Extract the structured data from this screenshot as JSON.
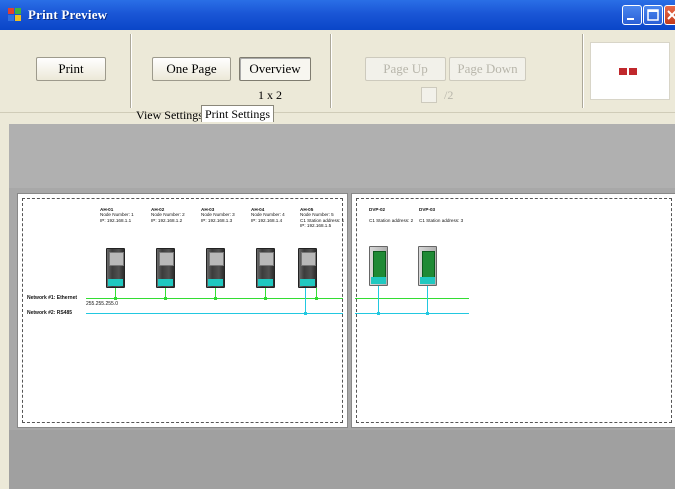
{
  "window": {
    "title": "Print Preview",
    "colors": {
      "titlebar": "#1a56d6",
      "close_button": "#c33b1a"
    }
  },
  "toolbar": {
    "print_label": "Print",
    "one_page_label": "One Page",
    "overview_label": "Overview",
    "overview_pressed": true,
    "page_layout": "1 x 2",
    "page_up_label": "Page Up",
    "page_down_label": "Page Down",
    "page_up_enabled": false,
    "page_down_enabled": false,
    "page_number": "",
    "page_total": "/2"
  },
  "tabs": [
    {
      "label": "View Settings",
      "active": false
    },
    {
      "label": "Print Settings",
      "active": true
    }
  ],
  "preview": {
    "networks": [
      {
        "label": "Network #1: Ethernet",
        "color": "#33dd33",
        "ip": "255.255.255.0"
      },
      {
        "label": "Network #2: RS485",
        "color": "#22c8e0"
      }
    ],
    "page1_devices": [
      {
        "name": "AH-01",
        "line1": "Node Number: 1",
        "line2": "IP: 192.168.1.1"
      },
      {
        "name": "AH-02",
        "line1": "Node Number: 2",
        "line2": "IP: 192.168.1.2"
      },
      {
        "name": "AH-03",
        "line1": "Node Number: 3",
        "line2": "IP: 192.168.1.3"
      },
      {
        "name": "AH-04",
        "line1": "Node Number: 4",
        "line2": "IP: 192.168.1.4"
      },
      {
        "name": "AH-05",
        "line1": "Node Number: 5",
        "line2": "C1 Station address: 1",
        "line3": "IP: 192.168.1.5"
      }
    ],
    "page2_devices": [
      {
        "name": "DVP-02",
        "line1": "C1 Station address: 2"
      },
      {
        "name": "DVP-03",
        "line1": "C1 Station address: 3"
      }
    ]
  }
}
